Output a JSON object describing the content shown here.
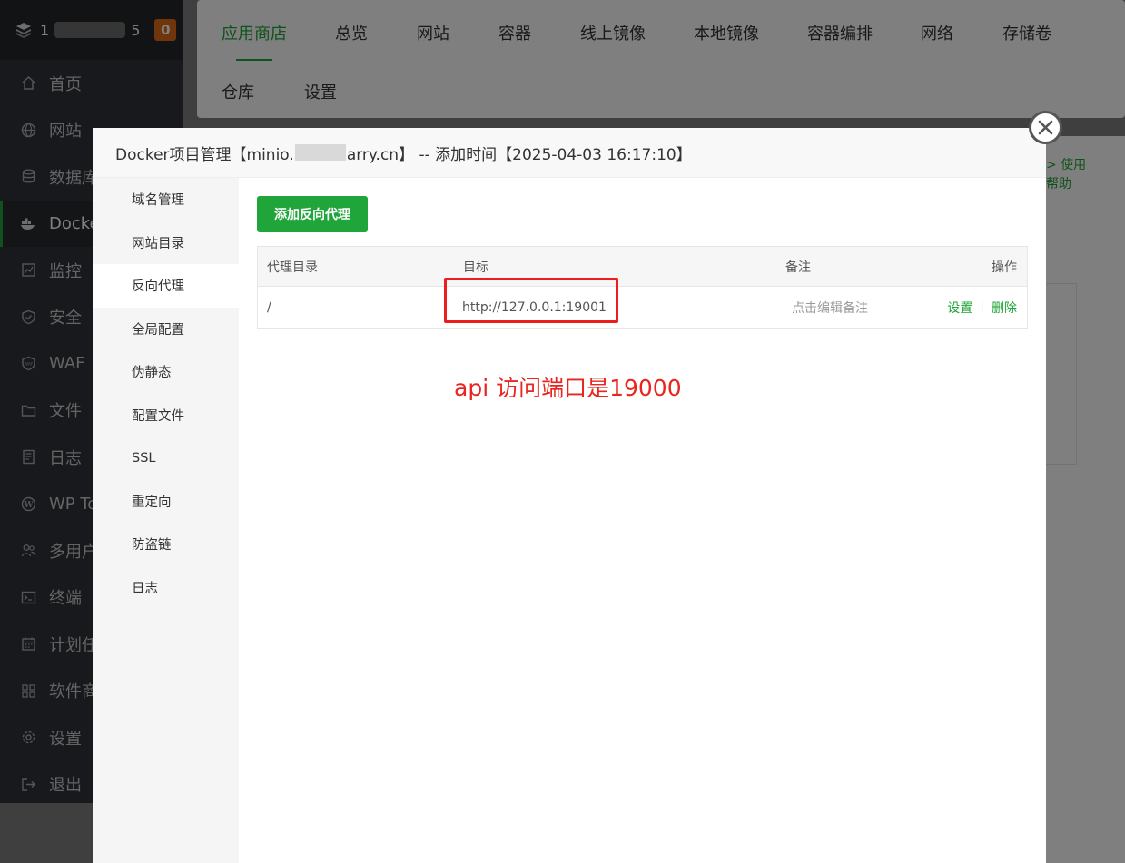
{
  "sidebar": {
    "logo_left": "1",
    "logo_right": "5",
    "badge": "0",
    "items": [
      {
        "label": "首页",
        "icon": "home-icon"
      },
      {
        "label": "网站",
        "icon": "globe-icon"
      },
      {
        "label": "数据库",
        "icon": "database-icon"
      },
      {
        "label": "Docker",
        "icon": "docker-icon",
        "active": true
      },
      {
        "label": "监控",
        "icon": "monitor-icon"
      },
      {
        "label": "安全",
        "icon": "shield-icon"
      },
      {
        "label": "WAF",
        "icon": "waf-shield-icon"
      },
      {
        "label": "文件",
        "icon": "folder-icon"
      },
      {
        "label": "日志",
        "icon": "log-icon"
      },
      {
        "label": "WP To",
        "icon": "wordpress-icon"
      },
      {
        "label": "多用户",
        "icon": "users-icon"
      },
      {
        "label": "终端",
        "icon": "terminal-icon"
      },
      {
        "label": "计划任",
        "icon": "calendar-icon"
      },
      {
        "label": "软件商",
        "icon": "apps-icon"
      },
      {
        "label": "设置",
        "icon": "gear-icon"
      },
      {
        "label": "退出",
        "icon": "logout-icon"
      }
    ]
  },
  "topnav": {
    "tabs_row1": [
      "应用商店",
      "总览",
      "网站",
      "容器",
      "线上镜像",
      "本地镜像",
      "容器编排",
      "网络",
      "存储卷"
    ],
    "tabs_row2": [
      "仓库",
      "设置"
    ],
    "active_tab": "应用商店"
  },
  "background": {
    "help_line1": "> 使用",
    "help_line2": "帮助"
  },
  "modal": {
    "title_prefix": "Docker项目管理【minio.",
    "title_suffix": "arry.cn】 -- 添加时间【2025-04-03 16:17:10】",
    "menu": [
      "域名管理",
      "网站目录",
      "反向代理",
      "全局配置",
      "伪静态",
      "配置文件",
      "SSL",
      "重定向",
      "防盗链",
      "日志"
    ],
    "active_menu": "反向代理",
    "add_button": "添加反向代理",
    "table": {
      "headers": [
        "代理目录",
        "目标",
        "备注",
        "操作"
      ],
      "rows": [
        {
          "path": "/",
          "target": "http://127.0.0.1:19001",
          "note": "点击编辑备注",
          "op_settings": "设置",
          "op_delete": "删除"
        }
      ]
    },
    "annotation": "api 访问端口是19000"
  },
  "colors": {
    "accent": "#20a53a",
    "annotation_red": "#e8261f",
    "badge_orange": "#e16b15",
    "sidebar_bg": "#2f3338"
  }
}
